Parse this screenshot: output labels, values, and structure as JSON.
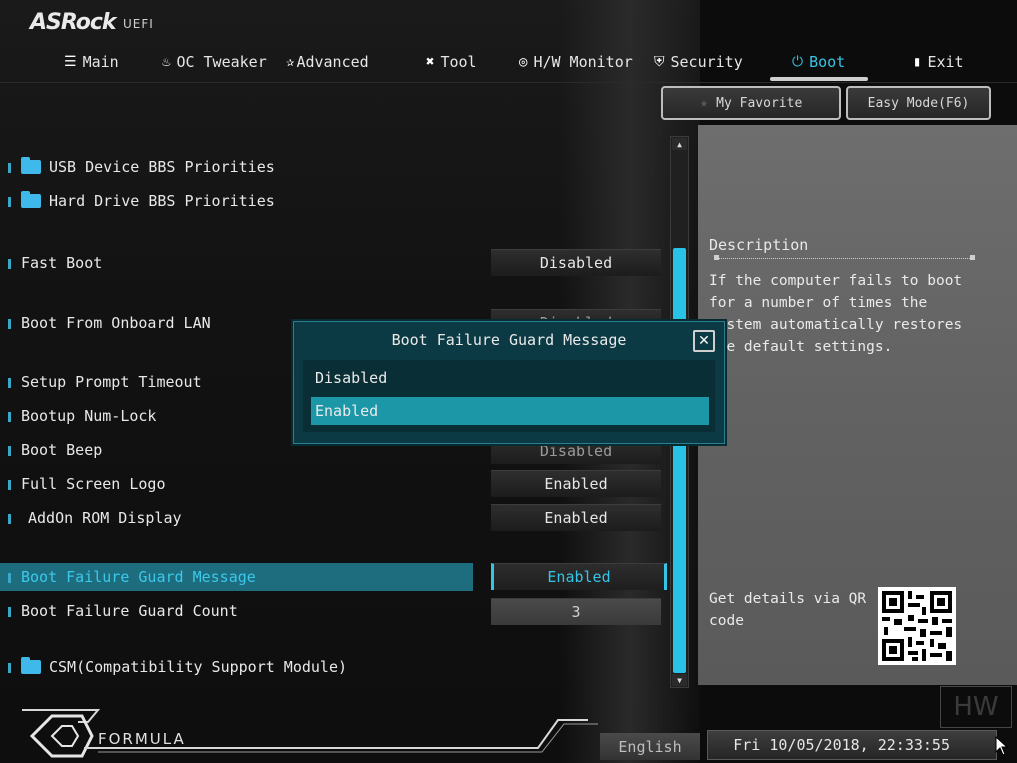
{
  "brand": {
    "name": "ASRock",
    "sub": "UEFI"
  },
  "nav": [
    {
      "label": "Main",
      "icon": "list-icon"
    },
    {
      "label": "OC Tweaker",
      "icon": "flame-icon"
    },
    {
      "label": "Advanced",
      "icon": "star-icon"
    },
    {
      "label": "Tool",
      "icon": "tools-icon"
    },
    {
      "label": "H/W Monitor",
      "icon": "monitor-icon"
    },
    {
      "label": "Security",
      "icon": "shield-icon"
    },
    {
      "label": "Boot",
      "icon": "power-icon"
    },
    {
      "label": "Exit",
      "icon": "exit-door-icon"
    }
  ],
  "active_tab": "Boot",
  "top_buttons": {
    "favorite": "My Favorite",
    "easy_mode": "Easy Mode(F6)"
  },
  "settings": [
    {
      "label": "USB Device BBS Priorities",
      "type": "folder"
    },
    {
      "label": "Hard Drive BBS Priorities",
      "type": "folder"
    },
    {
      "label": "Fast Boot",
      "value": "Disabled"
    },
    {
      "label": "Boot From Onboard LAN",
      "value": "Disabled"
    },
    {
      "label": "Setup Prompt Timeout",
      "value": ""
    },
    {
      "label": "Bootup Num-Lock",
      "value": ""
    },
    {
      "label": "Boot Beep",
      "value": "Disabled"
    },
    {
      "label": "Full Screen Logo",
      "value": "Enabled"
    },
    {
      "label": "AddOn ROM Display",
      "value": "Enabled"
    },
    {
      "label": "Boot Failure Guard Message",
      "value": "Enabled"
    },
    {
      "label": "Boot Failure Guard Count",
      "value": "3"
    },
    {
      "label": "CSM(Compatibility Support Module)",
      "type": "folder"
    }
  ],
  "description": {
    "title": "Description",
    "text": "If the computer fails to boot for a number of times the system automatically restores the default settings.",
    "qr_text": "Get details via QR code"
  },
  "modal": {
    "title": "Boot Failure Guard Message",
    "options": [
      "Disabled",
      "Enabled"
    ],
    "selected": "Enabled"
  },
  "footer": {
    "formula": "FORMULA",
    "language": "English",
    "datetime": "Fri 10/05/2018, 22:33:55"
  },
  "watermark": "HW"
}
